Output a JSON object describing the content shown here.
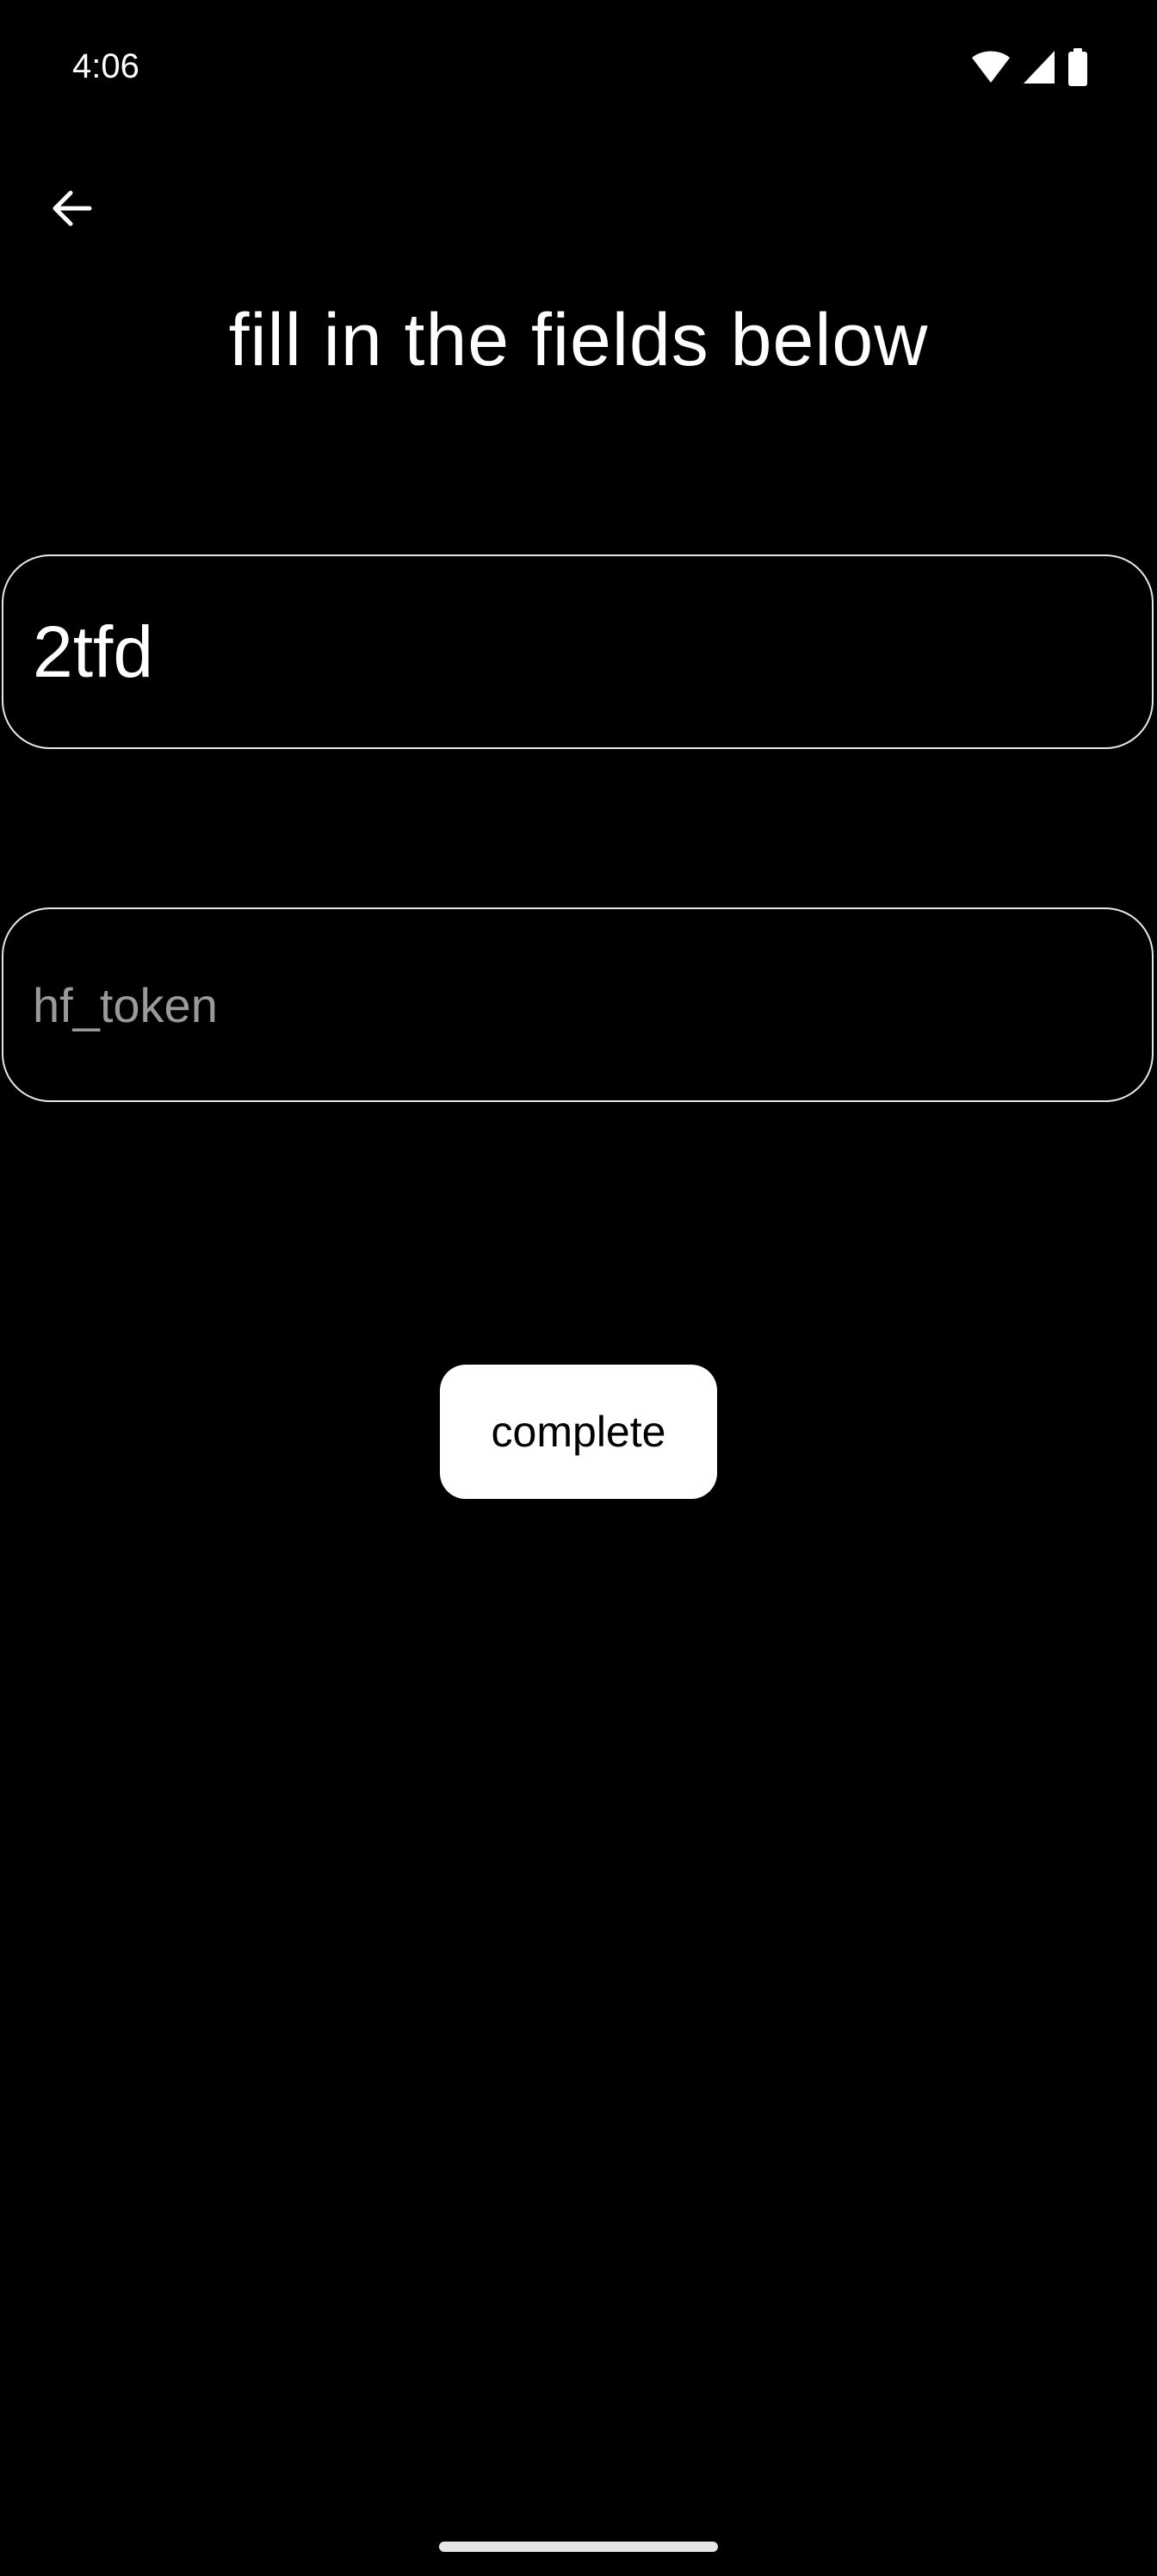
{
  "status_bar": {
    "time": "4:06",
    "icons": [
      "wifi-icon",
      "cell-signal-icon",
      "battery-icon"
    ]
  },
  "header": {
    "back_icon": "arrow-left-icon",
    "title": "fill in the fields below"
  },
  "form": {
    "name_field": {
      "value": "2tfd",
      "placeholder": ""
    },
    "token_field": {
      "value": "",
      "placeholder": "hf_token"
    },
    "complete_label": "complete"
  },
  "colors": {
    "background": "#000000",
    "text": "#ffffff",
    "field_border": "#e6e6e6",
    "placeholder": "#9a9a9a",
    "button_background": "#ffffff",
    "button_text": "#000000"
  }
}
